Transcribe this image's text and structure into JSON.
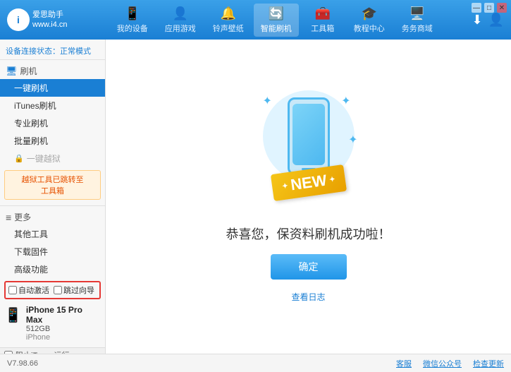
{
  "app": {
    "logo_text_line1": "爱思助手",
    "logo_text_line2": "www.i4.cn",
    "logo_letter": "i"
  },
  "nav": {
    "tabs": [
      {
        "id": "my-device",
        "label": "我的设备",
        "icon": "📱"
      },
      {
        "id": "apps-games",
        "label": "应用游戏",
        "icon": "👤"
      },
      {
        "id": "ringtone",
        "label": "铃声壁纸",
        "icon": "🔔"
      },
      {
        "id": "smart-flash",
        "label": "智能刷机",
        "icon": "🔄"
      },
      {
        "id": "toolbox",
        "label": "工具箱",
        "icon": "🧰"
      },
      {
        "id": "tutorial",
        "label": "教程中心",
        "icon": "🎓"
      },
      {
        "id": "service",
        "label": "务务商域",
        "icon": "🖥️"
      }
    ],
    "active_tab": "smart-flash"
  },
  "header_right": {
    "download_icon": "⬇",
    "user_icon": "👤"
  },
  "win_controls": {
    "min": "—",
    "max": "□",
    "close": "✕"
  },
  "sidebar": {
    "status_label": "设备连接状态：",
    "status_value": "正常模式",
    "sections": [
      {
        "id": "flash",
        "icon": "🖥",
        "label": "刷机",
        "items": [
          {
            "id": "onekey-flash",
            "label": "一键刷机",
            "active": true
          },
          {
            "id": "itunes-flash",
            "label": "iTunes刷机",
            "active": false
          },
          {
            "id": "pro-flash",
            "label": "专业刷机",
            "active": false
          },
          {
            "id": "batch-flash",
            "label": "批量刷机",
            "active": false
          }
        ],
        "disabled_items": [
          {
            "id": "onekey-jailbreak",
            "label": "一键越狱"
          }
        ],
        "notice": "越狱工具已跳转至\n工具箱"
      },
      {
        "id": "more",
        "icon": "≡",
        "label": "更多",
        "items": [
          {
            "id": "other-tools",
            "label": "其他工具"
          },
          {
            "id": "download-firmware",
            "label": "下载固件"
          },
          {
            "id": "advanced",
            "label": "高级功能"
          }
        ]
      }
    ]
  },
  "device": {
    "name": "iPhone 15 Pro Max",
    "storage": "512GB",
    "type": "iPhone",
    "icon": "📱"
  },
  "auto_options": {
    "auto_activate": "自动激活",
    "skip_guide": "跳过向导"
  },
  "itunes": {
    "label": "阻止iTunes运行"
  },
  "main": {
    "success_title": "恭喜您，保资料刷机成功啦！",
    "confirm_btn": "确定",
    "view_log": "查看日志",
    "new_badge": "NEW"
  },
  "footer": {
    "version": "V7.98.66",
    "links": [
      "客服",
      "微信公众号",
      "检查更新"
    ]
  }
}
